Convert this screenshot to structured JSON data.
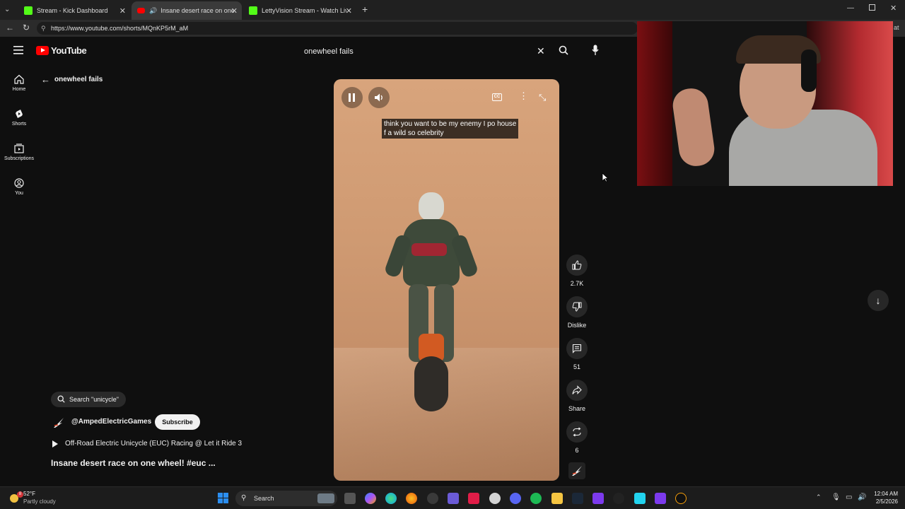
{
  "browser": {
    "tabs": [
      {
        "label": "Stream - Kick Dashboard",
        "active": false
      },
      {
        "label": "Insane desert race on one wh",
        "active": true
      },
      {
        "label": "LettyVision Stream - Watch Live o",
        "active": false
      }
    ],
    "url": "https://www.youtube.com/shorts/MQnKP5rM_aM",
    "address_overflow": "at"
  },
  "youtube": {
    "logo_text": "YouTube",
    "search_query": "onewheel fails",
    "back_label": "onewheel fails",
    "sidebar": [
      {
        "label": "Home",
        "icon": "home-icon"
      },
      {
        "label": "Shorts",
        "icon": "shorts-icon"
      },
      {
        "label": "Subscriptions",
        "icon": "subscriptions-icon"
      },
      {
        "label": "You",
        "icon": "you-icon"
      }
    ],
    "caption_lines": [
      "think you want to be my enemy I po house",
      "f a wild so celebrity"
    ],
    "actions": {
      "likes": "2.7K",
      "dislike": "Dislike",
      "comments": "51",
      "share": "Share",
      "remix": "6"
    },
    "search_chip": "Search \"unicycle\"",
    "channel": "@AmpedElectricGames",
    "subscribe": "Subscribe",
    "playlist": "Off-Road Electric Unicycle (EUC) Racing @ Let it Ride 3",
    "title": "Insane desert race on one wheel! #euc ..."
  },
  "taskbar": {
    "weather_temp": "52°F",
    "weather_desc": "Partly cloudy",
    "weather_badge": "8",
    "search_label": "Search",
    "time": "12:04 AM",
    "date": "2/5/2026"
  },
  "colors": {
    "youtube_red": "#ff0000",
    "kick_green": "#53fc18",
    "bg": "#0f0f0f"
  }
}
